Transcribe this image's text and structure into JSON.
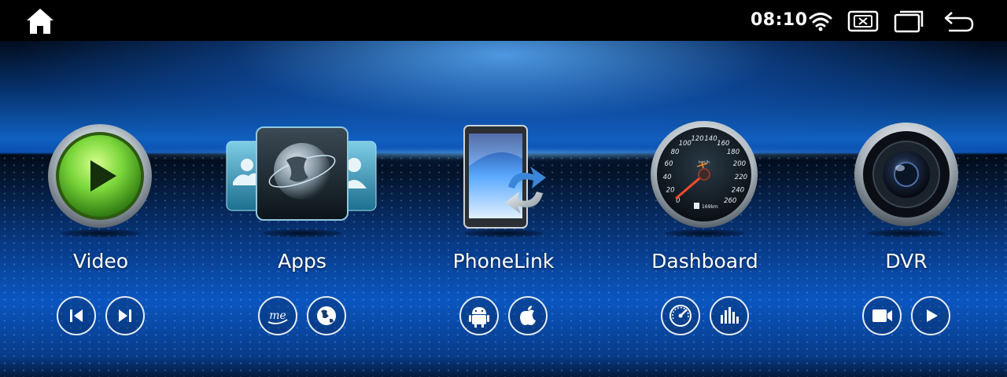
{
  "status_bar": {
    "time": "08:10",
    "icons": [
      "home-icon",
      "wifi-icon",
      "close-screen-icon",
      "multitask-icon",
      "back-icon"
    ]
  },
  "tiles": [
    {
      "label": "Video",
      "icon": "play-icon",
      "buttons": [
        "skip-previous-icon",
        "skip-next-icon"
      ]
    },
    {
      "label": "Apps",
      "icon": "globe-icon",
      "buttons": [
        "me-icon",
        "globe-icon"
      ]
    },
    {
      "label": "PhoneLink",
      "icon": "phone-sync-icon",
      "buttons": [
        "android-icon",
        "apple-icon"
      ]
    },
    {
      "label": "Dashboard",
      "icon": "speedometer-icon",
      "buttons": [
        "gauge-icon",
        "equalizer-icon"
      ],
      "gauge": {
        "ticks": [
          "0",
          "20",
          "40",
          "60",
          "80",
          "100",
          "120",
          "140",
          "160",
          "180",
          "200",
          "220",
          "240",
          "260"
        ],
        "unit": "km/h",
        "odometer": "169km"
      }
    },
    {
      "label": "DVR",
      "icon": "camera-lens-icon",
      "buttons": [
        "video-camera-icon",
        "play-icon"
      ]
    }
  ],
  "colors": {
    "accent_blue": "#1060c0",
    "video_green": "#7ad63a",
    "needle_red": "#ff4a2a"
  }
}
